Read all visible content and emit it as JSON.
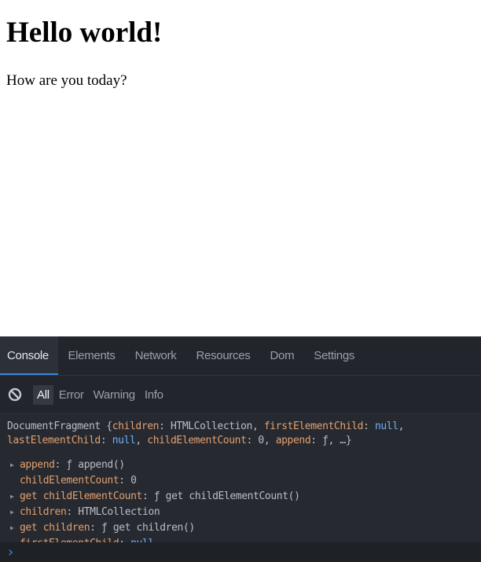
{
  "page": {
    "heading": "Hello world!",
    "paragraph": "How are you today?"
  },
  "devtools": {
    "tabs": [
      "Console",
      "Elements",
      "Network",
      "Resources",
      "Dom",
      "Settings"
    ],
    "active_tab": "Console",
    "filters": [
      "All",
      "Error",
      "Warning",
      "Info"
    ],
    "active_filter": "All",
    "accent": "#3a86e0",
    "log": {
      "summary": {
        "type": "DocumentFragment",
        "open": " {",
        "k1": "children",
        "v1": " HTMLCollection, ",
        "k2": "firstElementChild",
        "v2": "null",
        "k3": "lastElementChild",
        "v3": "null",
        "k4": "childElementCount",
        "v4": " 0, ",
        "k5": "append",
        "v5": " ƒ, …}"
      },
      "properties": [
        {
          "key": "append",
          "value": "ƒ append()",
          "expandable": true
        },
        {
          "key": "childElementCount",
          "value": "0",
          "expandable": false
        },
        {
          "key": "get childElementCount",
          "value": "ƒ get childElementCount()",
          "expandable": true
        },
        {
          "key": "children",
          "value": "HTMLCollection",
          "expandable": true
        },
        {
          "key": "get children",
          "value": "ƒ get children()",
          "expandable": true
        },
        {
          "key": "firstElementChild",
          "value": "null",
          "expandable": false
        }
      ]
    }
  }
}
